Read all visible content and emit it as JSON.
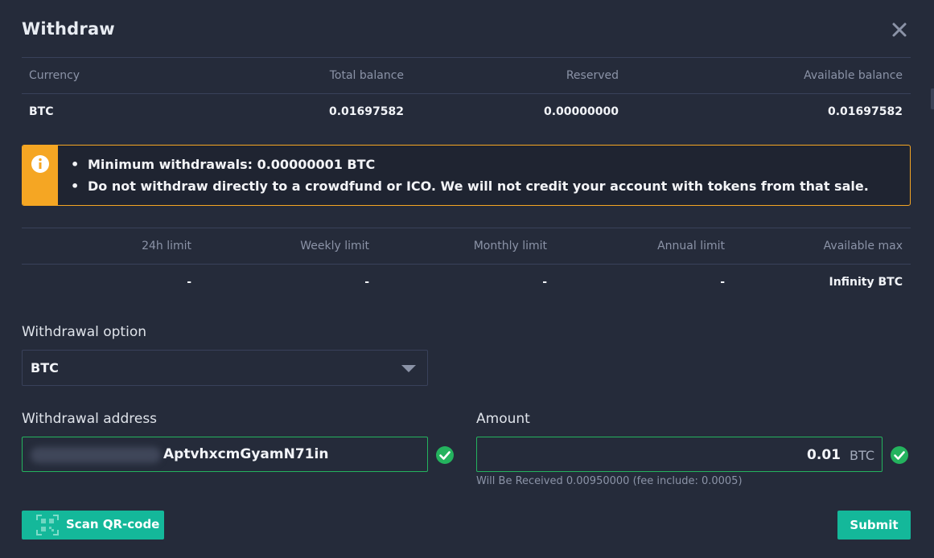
{
  "modal": {
    "title": "Withdraw",
    "close_icon": "close-icon"
  },
  "balance_table": {
    "headers": [
      "Currency",
      "Total balance",
      "Reserved",
      "Available balance"
    ],
    "row": {
      "currency": "BTC",
      "total_balance": "0.01697582",
      "reserved": "0.00000000",
      "available_balance": "0.01697582"
    }
  },
  "notice": {
    "icon": "info-icon",
    "accent_color": "#f5a623",
    "items": [
      "Minimum withdrawals: 0.00000001 BTC",
      "Do not withdraw directly to a crowdfund or ICO. We will not credit your account with tokens from that sale."
    ]
  },
  "limits_table": {
    "headers": [
      "24h limit",
      "Weekly limit",
      "Monthly limit",
      "Annual limit",
      "Available max"
    ],
    "values": [
      "-",
      "-",
      "-",
      "-",
      "Infinity BTC"
    ]
  },
  "withdrawal_option": {
    "label": "Withdrawal option",
    "selected": "BTC"
  },
  "withdrawal_address": {
    "label": "Withdrawal address",
    "visible_value": "AptvhxcmGyamN71in",
    "valid": true
  },
  "amount": {
    "label": "Amount",
    "value": "0.01",
    "unit": "BTC",
    "valid": true,
    "hint": "Will Be Received 0.00950000 (fee include: 0.0005)"
  },
  "actions": {
    "scan_label": "Scan QR-code",
    "submit_label": "Submit",
    "button_color": "#14b89a"
  },
  "colors": {
    "background": "#252b3a",
    "valid_green": "#24b35e",
    "muted_text": "#8b93a7"
  }
}
